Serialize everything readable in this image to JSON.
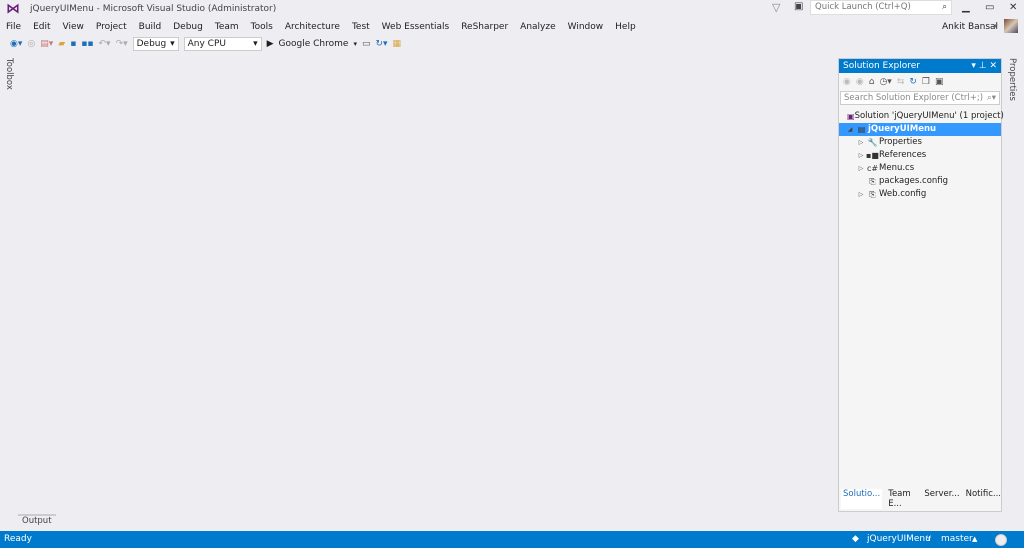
{
  "window": {
    "title": "jQueryUIMenu - Microsoft Visual Studio (Administrator)",
    "quick_launch_placeholder": "Quick Launch (Ctrl+Q)",
    "user": "Ankit Bansal"
  },
  "menu": [
    "File",
    "Edit",
    "View",
    "Project",
    "Build",
    "Debug",
    "Team",
    "Tools",
    "Architecture",
    "Test",
    "Web Essentials",
    "ReSharper",
    "Analyze",
    "Window",
    "Help"
  ],
  "toolbar": {
    "config": "Debug",
    "platform": "Any CPU",
    "run_target": "Google Chrome"
  },
  "side_tabs": {
    "toolbox": "Toolbox",
    "properties": "Properties",
    "output": "Output"
  },
  "solution_explorer": {
    "title": "Solution Explorer",
    "search_placeholder": "Search Solution Explorer (Ctrl+;)",
    "solution": "Solution 'jQueryUIMenu' (1 project)",
    "project": "jQueryUIMenu",
    "items": [
      {
        "label": "Properties",
        "icon": "wrench",
        "expandable": true
      },
      {
        "label": "References",
        "icon": "references",
        "expandable": true
      },
      {
        "label": "Menu.cs",
        "icon": "csharp",
        "expandable": true
      },
      {
        "label": "packages.config",
        "icon": "config",
        "expandable": false
      },
      {
        "label": "Web.config",
        "icon": "config",
        "expandable": true
      }
    ],
    "tabs": [
      "Solutio...",
      "Team E...",
      "Server...",
      "Notific..."
    ]
  },
  "status": {
    "text": "Ready",
    "repo": "jQueryUIMenu",
    "branch": "master"
  },
  "colors": {
    "accent": "#007acc",
    "selection": "#3399ff",
    "bg": "#eeeef2"
  }
}
